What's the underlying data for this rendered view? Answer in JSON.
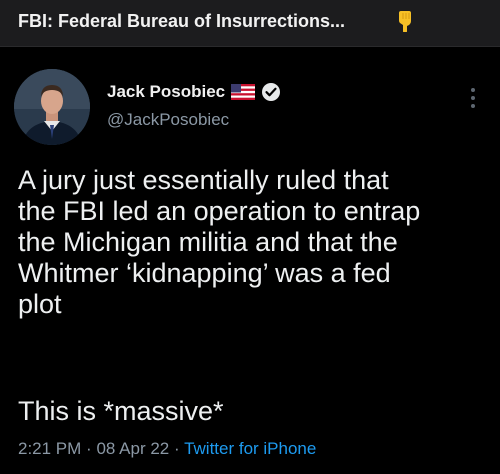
{
  "topbar": {
    "title": "FBI: Federal Bureau of Insurrections..."
  },
  "tweet": {
    "display_name": "Jack Posobiec",
    "handle": "@JackPosobiec",
    "text_lines": [
      "A jury just essentially ruled that",
      "the FBI led an operation to entrap",
      "the Michigan militia and that the",
      "Whitmer ‘kidnapping’ was a fed",
      "plot"
    ],
    "text_second": "This is *massive*",
    "time": "2:21 PM",
    "separator": "·",
    "date": "08 Apr 22",
    "source": "Twitter for iPhone"
  },
  "icons": {
    "emoji": "point-down-icon",
    "flag": "us-flag-icon",
    "verified": "verified-badge-icon",
    "more": "more-vertical-icon"
  },
  "colors": {
    "background": "#000000",
    "topbar_background": "#1c1c1e",
    "text": "#e7e9ea",
    "secondary_text": "#8b98a5",
    "link": "#1d9bf0"
  }
}
